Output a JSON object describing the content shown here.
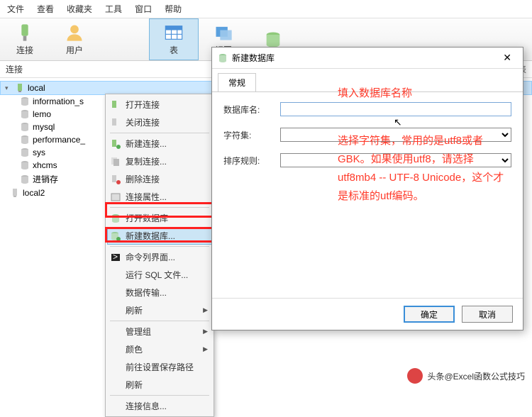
{
  "menu": {
    "items": [
      "文件",
      "查看",
      "收藏夹",
      "工具",
      "窗口",
      "帮助"
    ]
  },
  "toolbar": {
    "connect": "连接",
    "user": "用户",
    "table": "表",
    "view": "视图"
  },
  "subbar": {
    "title": "连接",
    "open_table": "打开表"
  },
  "tree": {
    "root": "local",
    "children": [
      "information_s",
      "lemo",
      "mysql",
      "performance_",
      "sys",
      "xhcms",
      "进销存"
    ],
    "root2": "local2"
  },
  "ctx": {
    "open_conn": "打开连接",
    "close_conn": "关闭连接",
    "new_conn": "新建连接...",
    "copy_conn": "复制连接...",
    "del_conn": "删除连接",
    "conn_prop": "连接属性...",
    "open_db": "打开数据库",
    "new_db": "新建数据库...",
    "cmd": "命令列界面...",
    "run_sql": "运行 SQL 文件...",
    "transfer": "数据传输...",
    "refresh": "刷新",
    "mgmt": "管理组",
    "color": "颜色",
    "goto": "前往设置保存路径",
    "refresh2": "刷新",
    "conn_info": "连接信息..."
  },
  "dialog": {
    "title": "新建数据库",
    "tab": "常规",
    "db_name": "数据库名:",
    "charset": "字符集:",
    "collation": "排序规则:",
    "ok": "确定",
    "cancel": "取消"
  },
  "annot": {
    "name_hint": "填入数据库名称",
    "charset_hint": "选择字符集，常用的是utf8或者GBK。如果使用utf8，请选择utf8mb4 -- UTF-8 Unicode，这个才是标准的utf编码。"
  },
  "watermark": "头条@Excel函数公式技巧"
}
